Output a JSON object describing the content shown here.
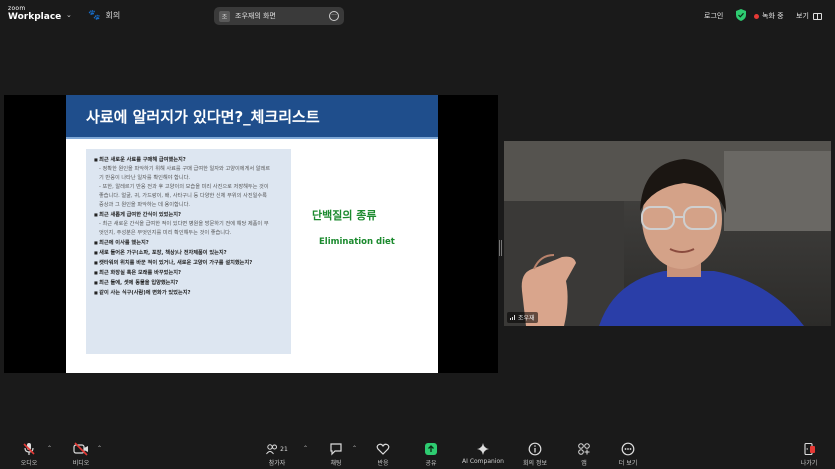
{
  "app": {
    "brand_top": "zoom",
    "brand_bottom": "Workplace",
    "meeting_tab_label": "회의"
  },
  "share_bar": {
    "avatar_letter": "조",
    "title": "조우재의 화면"
  },
  "top_right": {
    "login": "로그인",
    "recording": "녹화 중",
    "view": "보기"
  },
  "slide": {
    "title": "사료에 알러지가 있다면?_체크리스트",
    "checklist": [
      {
        "text": "최근 새로운 사료를 구매해 급여했는지?",
        "style": "bold"
      },
      {
        "text": "- 정확한 원인을 파악하기 위해 사료를 구매 급여한 일자와 고양이에게서 알레르",
        "style": "sub"
      },
      {
        "text": "기 반응이 나타난 일자를 확인해야 합니다.",
        "style": "sub"
      },
      {
        "text": "- 또한, 알레르기 반응 전과 후 고양이의 모습을 미리 사진으로 저장해두는 것이",
        "style": "sub"
      },
      {
        "text": "좋습니다. 얼굴, 귀, 가드랑이, 배, 사타구니 등 다양한 신체 부위의 사진일수록",
        "style": "sub"
      },
      {
        "text": "증상과 그 원인을 파악하는 데 용이합니다.",
        "style": "sub"
      },
      {
        "text": "최근 새롭게 급여한 간식이 있었는지?",
        "style": "bold"
      },
      {
        "text": "- 최근 새로운 간식을 급여한 적이 있다면 병원을 방문하기 전에 해당 제품이 무",
        "style": "sub"
      },
      {
        "text": "엇인지, 주성분은 무엇인지를 미리 확인해두는 것이 좋습니다.",
        "style": "sub"
      },
      {
        "text": "최근에 이사를 했는지?",
        "style": "bold"
      },
      {
        "text": "새로 들어온 가구(소파, 포장, 책상)나 전자제품이 있는지?",
        "style": "bold"
      },
      {
        "text": "캣타워의 위치를 바꾼 적이 있거나, 새로운 고양이 가구를 설치했는지?",
        "style": "bold"
      },
      {
        "text": "최근 화장실 혹은 모래를 바꾸었는지?",
        "style": "bold"
      },
      {
        "text": "최근 들에, 셋에 동물을 입양했는지?",
        "style": "bold"
      },
      {
        "text": "같이 사는 식구(사람)에 변화가 있었는지?",
        "style": "bold"
      }
    ],
    "side_title": "단백질의 종류",
    "side_subtitle": "Elimination diet"
  },
  "webcam": {
    "participant_name": "조우재"
  },
  "toolbar": {
    "audio": "오디오",
    "video": "비디오",
    "participants_count": "21",
    "participants": "참가자",
    "chat": "채팅",
    "reactions": "반응",
    "share": "공유",
    "ai_companion": "AI Companion",
    "meeting_info": "회의 정보",
    "apps": "앱",
    "more": "더 보기",
    "leave": "나가기"
  },
  "colors": {
    "slide_header": "#1f4e8c",
    "accent_green": "#1b8a2e",
    "share_green": "#2ecc71",
    "muted_red": "#e53935"
  }
}
